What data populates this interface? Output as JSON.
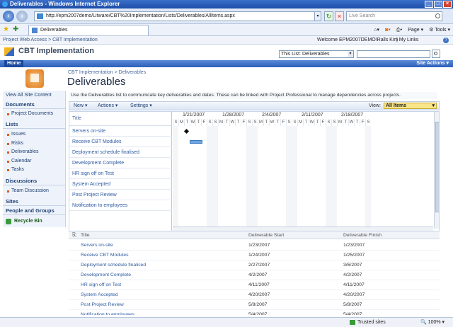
{
  "window": {
    "title": "Deliverables - Windows Internet Explorer"
  },
  "addressbar": {
    "url": "http://epm2007demo/Litware/CBT%20Implementation/Lists/Deliverables/AllItems.aspx",
    "search_placeholder": "Live Search"
  },
  "commandbar": {
    "tab_title": "Deliverables",
    "page_label": "Page",
    "tools_label": "Tools"
  },
  "sp_header": {
    "breadcrumb": "Project Web Access > CBT Implementation",
    "welcome": "Welcome EPM2007DEMO\\Ralls Kim",
    "my_links": "| My Links",
    "help": "?"
  },
  "site": {
    "title": "CBT Implementation",
    "scope_value": "This List: Deliverables"
  },
  "topnav": {
    "home": "Home",
    "site_actions": "Site Actions"
  },
  "page": {
    "crumb": "CBT Implementation > Deliverables",
    "title": "Deliverables",
    "description": "Use the Deliverables list to communicate key deliverables and dates. These can be linked with Project Professional to manage dependencies across projects."
  },
  "quicklaunch": {
    "view_all": "View All Site Content",
    "documents": "Documents",
    "project_documents": "Project Documents",
    "lists": "Lists",
    "list_items": [
      "Issues",
      "Risks",
      "Deliverables",
      "Calendar",
      "Tasks"
    ],
    "discussions": "Discussions",
    "team_discussion": "Team Discussion",
    "sites": "Sites",
    "people_groups": "People and Groups",
    "recycle_bin": "Recycle Bin"
  },
  "toolbar": {
    "new": "New",
    "actions": "Actions",
    "settings": "Settings",
    "view_label": "View:",
    "view_value": "All Items"
  },
  "gantt": {
    "title_header": "Title",
    "weeks": [
      "1/21/2007",
      "1/28/2007",
      "2/4/2007",
      "2/11/2007",
      "2/18/2007"
    ],
    "day_letters": [
      "S",
      "M",
      "T",
      "W",
      "T",
      "F",
      "S"
    ],
    "rows": [
      "Servers on-site",
      "Receive CBT Modules",
      "Deployment schedule finalised",
      "Development Complete",
      "HR sign off on Test",
      "System Accepted",
      "Post Project Review",
      "Notification to employees"
    ],
    "bars": [
      {
        "task": "Servers on-site",
        "type": "milestone",
        "start": "1/23/2007"
      },
      {
        "task": "Receive CBT Modules",
        "type": "bar",
        "start": "1/24/2007",
        "finish": "1/25/2007"
      }
    ]
  },
  "listview": {
    "headers": {
      "title": "Title",
      "start": "Deliverable Start",
      "finish": "Deliverable Finish"
    },
    "rows": [
      {
        "title": "Servers on-site",
        "start": "1/23/2007",
        "finish": "1/23/2007"
      },
      {
        "title": "Receive CBT Modules",
        "start": "1/24/2007",
        "finish": "1/25/2007"
      },
      {
        "title": "Deployment schedule finalised",
        "start": "2/27/2007",
        "finish": "3/6/2007"
      },
      {
        "title": "Development Complete",
        "start": "4/2/2007",
        "finish": "4/2/2007"
      },
      {
        "title": "HR sign off on Test",
        "start": "4/11/2007",
        "finish": "4/11/2007"
      },
      {
        "title": "System Accepted",
        "start": "4/20/2007",
        "finish": "4/20/2007"
      },
      {
        "title": "Post Project Review",
        "start": "5/8/2007",
        "finish": "5/8/2007"
      },
      {
        "title": "Notification to employees",
        "start": "5/4/2007",
        "finish": "5/4/2007"
      }
    ]
  },
  "statusbar": {
    "trusted": "Trusted sites",
    "zoom": "100%"
  }
}
